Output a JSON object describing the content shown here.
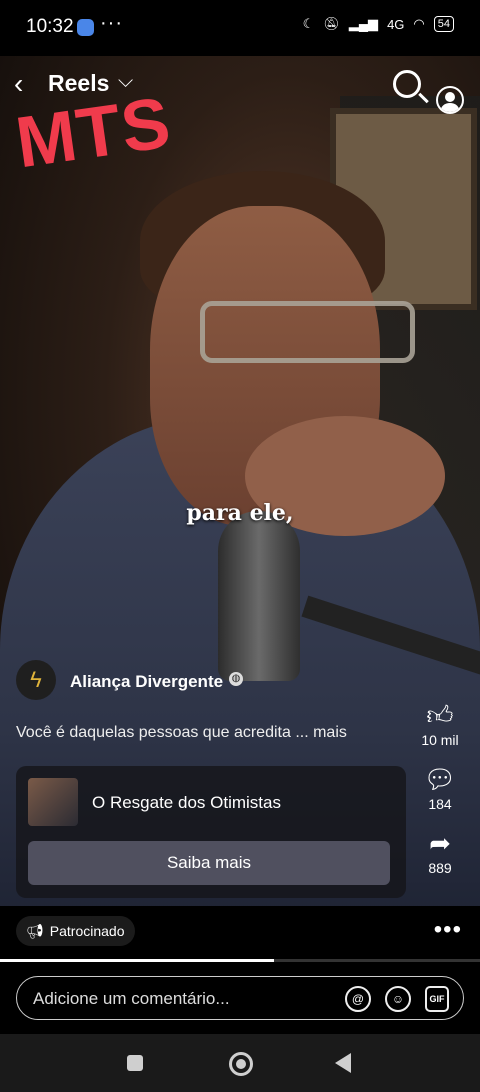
{
  "status": {
    "time": "10:32",
    "more": "···",
    "network": "4G",
    "battery": "54"
  },
  "header": {
    "title": "Reels",
    "chevron": "⌵"
  },
  "watermark": "MTS",
  "video": {
    "caption": "para ele,"
  },
  "post": {
    "channel": "Aliança Divergente",
    "description": "Você é daquelas pessoas que acredita ... mais"
  },
  "rail": {
    "likes": "10 mil",
    "comments": "184",
    "shares": "889"
  },
  "ad": {
    "title": "O Resgate dos Otimistas",
    "cta": "Saiba mais"
  },
  "footer": {
    "sponsored": "Patrocinado",
    "menu": "•••",
    "comment_placeholder": "Adicione um comentário...",
    "progress": 0.57
  },
  "icons": {
    "back": "back-arrow-icon",
    "search": "search-icon",
    "profile": "profile-icon",
    "like": "thumbs-up-icon",
    "comment": "comment-icon",
    "share": "share-icon",
    "globe": "globe-icon",
    "mention": "at-icon",
    "emoji": "emoji-icon",
    "gif": "gif-icon"
  },
  "colors": {
    "watermark": "#f03b4c",
    "cta_bg": "#50505f"
  }
}
